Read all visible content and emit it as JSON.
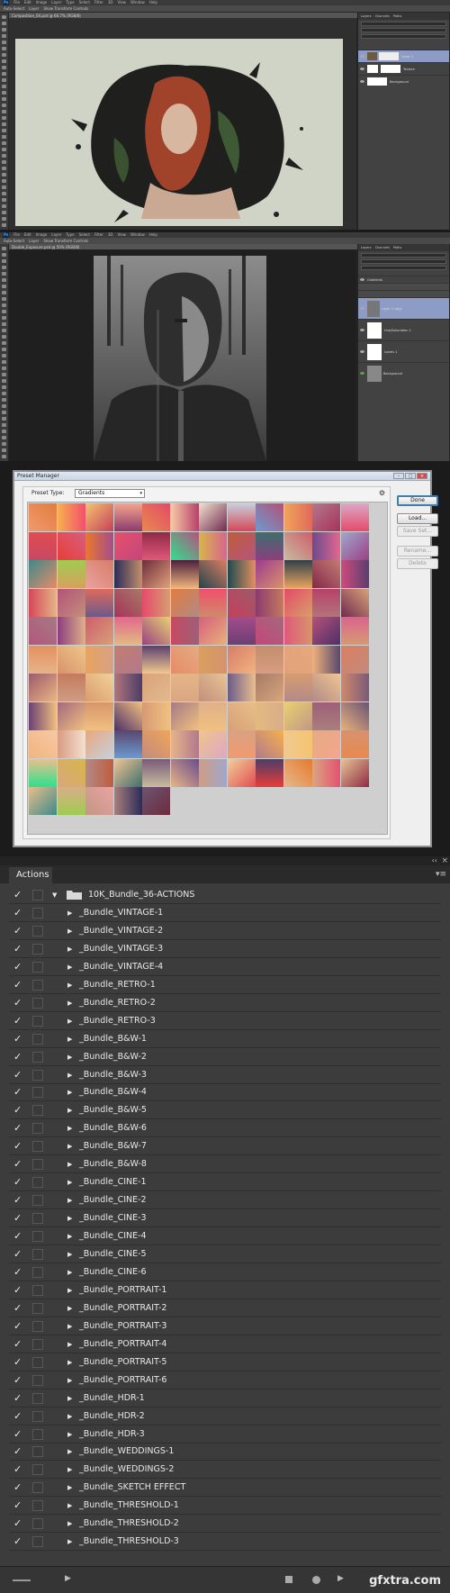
{
  "ps_window_1": {
    "menu": [
      "Ps",
      "File",
      "Edit",
      "Image",
      "Layer",
      "Type",
      "Select",
      "Filter",
      "3D",
      "View",
      "Window",
      "Help"
    ],
    "tab_title": "Composition_04.psd @ 66.7% (RGB/8)",
    "layer_names": [
      "Layer 1",
      "Texture",
      "Background"
    ]
  },
  "ps_window_2": {
    "menu": [
      "Ps",
      "File",
      "Edit",
      "Image",
      "Layer",
      "Type",
      "Select",
      "Filter",
      "3D",
      "View",
      "Window",
      "Help"
    ],
    "tab_title": "Double_Exposure.psd @ 50% (RGB/8)",
    "layer_names": [
      "Gradients",
      "Layer 1 copy",
      "Hue/Saturation 1",
      "Levels 1",
      "Background"
    ]
  },
  "preset_manager": {
    "title": "Preset Manager",
    "preset_type_label": "Preset Type:",
    "preset_type_value": "Gradients",
    "buttons": {
      "done": "Done",
      "load": "Load...",
      "save": "Save Set...",
      "rename": "Rename...",
      "delete": "Delete"
    },
    "swatches": [
      [
        "#f19a6e",
        "#f7b04e",
        "#f5c46f",
        "#f6a48d",
        "#e9894f",
        "#f7c9a4",
        "#f4e0d0",
        "#c7d0dd",
        "#6c9ad0",
        "#f0a55a",
        "#b2788c",
        "#dca7c4"
      ],
      [
        "#e14c4f",
        "#e93d39",
        "#e9792b",
        "#e6506f",
        "#8f2a44",
        "#2fe08d",
        "#d7b64a",
        "#c15c3c",
        "#3d6f6e",
        "#c7bd9f",
        "#6a4b8d",
        "#a0a7cf"
      ],
      [
        "#3d8a8a",
        "#9fcc4f",
        "#e9a3a0",
        "#2a2c5a",
        "#6e2c3c",
        "#4b1f3d",
        "#22444e",
        "#1c4a4f",
        "#9d3b8f",
        "#30404a",
        "#82284a",
        "#d04a7d"
      ],
      [
        "#d54757",
        "#b35277",
        "#e06a5a",
        "#a8325b",
        "#e54a6b",
        "#e27c3e",
        "#f24f6c",
        "#c53f5a",
        "#8c3a6e",
        "#e34b67",
        "#b7416a",
        "#6f2a4e"
      ],
      [
        "#b4567c",
        "#8b3f7e",
        "#cf5d6b",
        "#e3678e",
        "#9b4083",
        "#c84962",
        "#d75f7c",
        "#a44c8c",
        "#c5467a",
        "#e0587b",
        "#b6517d",
        "#d9648e"
      ],
      [
        "#e5905f",
        "#d8936a",
        "#e8a45f",
        "#c47c73",
        "#5a3f6f",
        "#e78b66",
        "#d8a05e",
        "#d77c69",
        "#c38f6c",
        "#e0a27a",
        "#eeb37c",
        "#dc7e61"
      ],
      [
        "#9d5a6b",
        "#c47a5f",
        "#d89e6c",
        "#b2757a",
        "#d9a27a",
        "#e5b588",
        "#c38f7c",
        "#6b5a8c",
        "#a67a66",
        "#d69d72",
        "#b18a86",
        "#cf8a6a"
      ],
      [
        "#6b3f72",
        "#a3697c",
        "#d8956b",
        "#4e2f68",
        "#d69a73",
        "#a47a84",
        "#e0b08a",
        "#d8a077",
        "#e3ba80",
        "#e8d170",
        "#9e5f78",
        "#e7b27a"
      ],
      [
        "#f1b47f",
        "#d89c82",
        "#e8a77c",
        "#58476e",
        "#c28b7d",
        "#e6b48a",
        "#f0c58b",
        "#d7a284",
        "#b07a8a",
        "#f2c98e",
        "#e4ac83",
        "#d6926f"
      ],
      [
        "#e9c08c",
        "#d8a67c",
        "#b28a88",
        "#f0c592",
        "#7a5a78",
        "#e8b685",
        "#cf9d82",
        "#f2d09a",
        "#4b3d68",
        "#e3b98e",
        "#d9a681",
        "#e7c494"
      ],
      [
        "#e7bf8a",
        "#d9ad88",
        "#c29785",
        "#a97e7c",
        "#6b5473"
      ]
    ]
  },
  "actions": {
    "tab": "Actions",
    "collapse_icon": "double-chevron-left-icon",
    "close_icon": "close-icon",
    "folder_name": "10K_Bundle_36-ACTIONS",
    "items": [
      "_Bundle_VINTAGE-1",
      "_Bundle_VINTAGE-2",
      "_Bundle_VINTAGE-3",
      "_Bundle_VINTAGE-4",
      "_Bundle_RETRO-1",
      "_Bundle_RETRO-2",
      "_Bundle_RETRO-3",
      "_Bundle_B&W-1",
      "_Bundle_B&W-2",
      "_Bundle_B&W-3",
      "_Bundle_B&W-4",
      "_Bundle_B&W-5",
      "_Bundle_B&W-6",
      "_Bundle_B&W-7",
      "_Bundle_B&W-8",
      "_Bundle_CINE-1",
      "_Bundle_CINE-2",
      "_Bundle_CINE-3",
      "_Bundle_CINE-4",
      "_Bundle_CINE-5",
      "_Bundle_CINE-6",
      "_Bundle_PORTRAIT-1",
      "_Bundle_PORTRAIT-2",
      "_Bundle_PORTRAIT-3",
      "_Bundle_PORTRAIT-4",
      "_Bundle_PORTRAIT-5",
      "_Bundle_PORTRAIT-6",
      "_Bundle_HDR-1",
      "_Bundle_HDR-2",
      "_Bundle_HDR-3",
      "_Bundle_WEDDINGS-1",
      "_Bundle_WEDDINGS-2",
      "_Bundle_SKETCH EFFECT",
      "_Bundle_THRESHOLD-1",
      "_Bundle_THRESHOLD-2",
      "_Bundle_THRESHOLD-3"
    ],
    "watermark": "gfxtra.com"
  }
}
